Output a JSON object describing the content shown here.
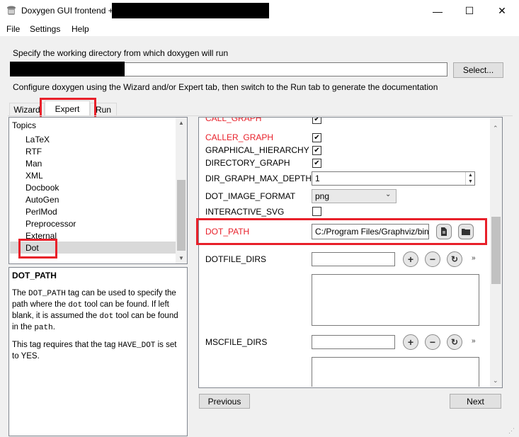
{
  "window": {
    "title": "Doxygen GUI frontend +"
  },
  "controls": {
    "minimize": "—",
    "maximize": "☐",
    "close": "✕"
  },
  "menu": [
    "File",
    "Settings",
    "Help"
  ],
  "workdir": {
    "label": "Specify the working directory from which doxygen will run",
    "value": "",
    "select_label": "Select...",
    "info": "Configure doxygen using the Wizard and/or Expert tab, then switch to the Run tab to generate the documentation"
  },
  "tabs": [
    "Wizard",
    "Expert",
    "Run"
  ],
  "topics": {
    "header": "Topics",
    "items": [
      "LaTeX",
      "RTF",
      "Man",
      "XML",
      "Docbook",
      "AutoGen",
      "PerlMod",
      "Preprocessor",
      "External",
      "Dot"
    ],
    "selected": "Dot"
  },
  "help": {
    "title": "DOT_PATH",
    "p1": {
      "a": "The ",
      "tag": "DOT_PATH",
      "b": " tag can be used to specify the path where the ",
      "dot": "dot",
      "c": " tool can be found. If left blank, it is assumed the ",
      "dot2": "dot",
      "d": " tool can be found in the ",
      "path": "path",
      "e": "."
    },
    "p2": {
      "a": "This tag requires that the tag ",
      "tag": "HAVE_DOT",
      "b": " is set to YES."
    }
  },
  "options": {
    "call_graph": "CALL_GRAPH",
    "caller_graph": "CALLER_GRAPH",
    "graphical_hierarchy": "GRAPHICAL_HIERARCHY",
    "directory_graph": "DIRECTORY_GRAPH",
    "dir_graph_max_depth": "DIR_GRAPH_MAX_DEPTH",
    "dir_graph_max_depth_value": "1",
    "dot_image_format": "DOT_IMAGE_FORMAT",
    "dot_image_format_value": "png",
    "interactive_svg": "INTERACTIVE_SVG",
    "dot_path": "DOT_PATH",
    "dot_path_value": "C:/Program Files/Graphviz/bin",
    "dotfile_dirs": "DOTFILE_DIRS",
    "mscfile_dirs": "MSCFILE_DIRS"
  },
  "nav": {
    "previous": "Previous",
    "next": "Next"
  },
  "colors": {
    "highlight": "#e8202a",
    "window_bg": "#f0f0f0"
  }
}
